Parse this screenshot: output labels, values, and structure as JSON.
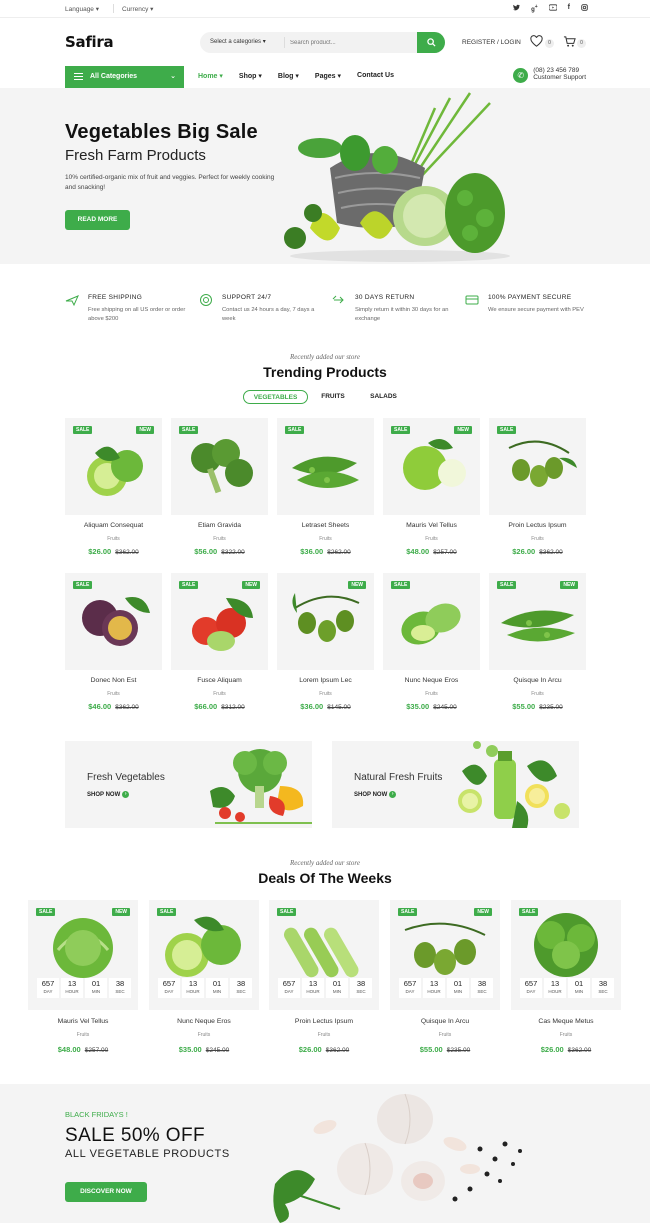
{
  "topbar": {
    "language": "Language ▾",
    "currency": "Currency ▾",
    "social_icons": [
      "twitter-icon",
      "google-plus-icon",
      "youtube-icon",
      "facebook-icon",
      "instagram-icon"
    ]
  },
  "header": {
    "logo": "Safira",
    "search_category": "Select a categories ▾",
    "search_placeholder": "Search product...",
    "account": "REGISTER / LOGIN",
    "wishlist_count": "0",
    "cart_count": "0"
  },
  "nav": {
    "all_categories": "All Categories",
    "items": [
      "Home",
      "Shop",
      "Blog",
      "Pages",
      "Contact Us"
    ],
    "support_phone": "(08) 23 456 789",
    "support_label": "Customer Support"
  },
  "hero": {
    "title": "Vegetables Big Sale",
    "subtitle": "Fresh Farm Products",
    "text": "10% certified-organic mix of fruit and veggies. Perfect for weekly cooking and snacking!",
    "button": "READ MORE"
  },
  "features": [
    {
      "title": "FREE SHIPPING",
      "desc": "Free shipping on all US order or order above $200"
    },
    {
      "title": "SUPPORT 24/7",
      "desc": "Contact us 24 hours a day, 7 days a week"
    },
    {
      "title": "30 DAYS RETURN",
      "desc": "Simply return it within 30 days for an exchange"
    },
    {
      "title": "100% PAYMENT SECURE",
      "desc": "We ensure secure payment with PEV"
    }
  ],
  "trending": {
    "kicker": "Recently added our store",
    "title": "Trending Products",
    "tabs": [
      "VEGETABLES",
      "FRUITS",
      "SALADS"
    ],
    "products": [
      {
        "name": "Aliquam Consequat",
        "cat": "Fruits",
        "price": "$26.00",
        "old": "$362.00",
        "sale": "SALE",
        "new": "NEW"
      },
      {
        "name": "Etiam Gravida",
        "cat": "Fruits",
        "price": "$56.00",
        "old": "$322.00",
        "sale": "SALE",
        "new": ""
      },
      {
        "name": "Letraset Sheets",
        "cat": "Fruits",
        "price": "$36.00",
        "old": "$262.00",
        "sale": "SALE",
        "new": ""
      },
      {
        "name": "Mauris Vel Tellus",
        "cat": "Fruits",
        "price": "$48.00",
        "old": "$257.00",
        "sale": "SALE",
        "new": "NEW"
      },
      {
        "name": "Proin Lectus Ipsum",
        "cat": "Fruits",
        "price": "$26.00",
        "old": "$362.00",
        "sale": "SALE",
        "new": ""
      },
      {
        "name": "Donec Non Est",
        "cat": "Fruits",
        "price": "$46.00",
        "old": "$362.00",
        "sale": "SALE",
        "new": ""
      },
      {
        "name": "Fusce Aliquam",
        "cat": "Fruits",
        "price": "$66.00",
        "old": "$312.00",
        "sale": "SALE",
        "new": "NEW"
      },
      {
        "name": "Lorem Ipsum Lec",
        "cat": "Fruits",
        "price": "$36.00",
        "old": "$145.00",
        "sale": "",
        "new": "NEW"
      },
      {
        "name": "Nunc Neque Eros",
        "cat": "Fruits",
        "price": "$35.00",
        "old": "$245.00",
        "sale": "SALE",
        "new": ""
      },
      {
        "name": "Quisque In Arcu",
        "cat": "Fruits",
        "price": "$55.00",
        "old": "$235.00",
        "sale": "SALE",
        "new": "NEW"
      }
    ]
  },
  "banners": [
    {
      "title": "Fresh Vegetables",
      "link": "SHOP NOW"
    },
    {
      "title": "Natural Fresh Fruits",
      "link": "SHOP NOW"
    }
  ],
  "deals": {
    "kicker": "Recently added our store",
    "title": "Deals Of The Weeks",
    "timer_labels": [
      "DAY",
      "HOUR",
      "MIN",
      "SEC"
    ],
    "timer_values": [
      "657",
      "13",
      "01",
      "38"
    ],
    "products": [
      {
        "name": "Mauris Vel Tellus",
        "cat": "Fruits",
        "price": "$48.00",
        "old": "$257.00",
        "sale": "SALE",
        "new": "NEW"
      },
      {
        "name": "Nunc Neque Eros",
        "cat": "Fruits",
        "price": "$35.00",
        "old": "$245.00",
        "sale": "SALE",
        "new": ""
      },
      {
        "name": "Proin Lectus Ipsum",
        "cat": "Fruits",
        "price": "$26.00",
        "old": "$362.00",
        "sale": "SALE",
        "new": ""
      },
      {
        "name": "Quisque In Arcu",
        "cat": "Fruits",
        "price": "$55.00",
        "old": "$235.00",
        "sale": "SALE",
        "new": "NEW"
      },
      {
        "name": "Cas Meque Metus",
        "cat": "Fruits",
        "price": "$26.00",
        "old": "$362.00",
        "sale": "SALE",
        "new": ""
      }
    ]
  },
  "bottom_banner": {
    "kicker": "BLACK FRIDAYS !",
    "title": "SALE 50% OFF",
    "subtitle": "ALL VEGETABLE PRODUCTS",
    "button": "DISCOVER NOW"
  },
  "colors": {
    "accent": "#3eac4a",
    "panel": "#f4f4f4"
  }
}
